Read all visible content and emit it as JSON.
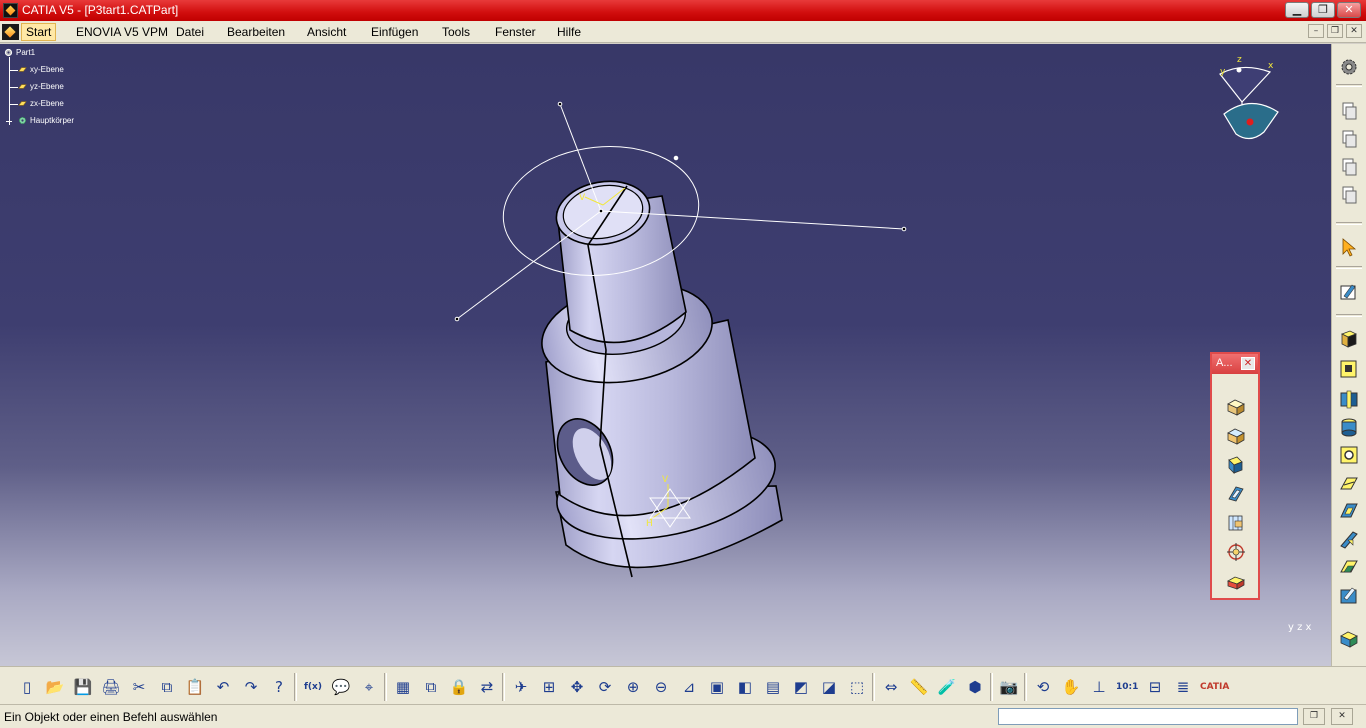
{
  "window": {
    "title": "CATIA V5 - [P3tart1.CATPart]",
    "minimize_glyph": "▁",
    "maximize_glyph": "❐",
    "close_glyph": "✕"
  },
  "menu": {
    "items": [
      "Start",
      "ENOVIA V5 VPM",
      "Datei",
      "Bearbeiten",
      "Ansicht",
      "Einfügen",
      "Tools",
      "Fenster",
      "Hilfe"
    ],
    "mdi_minimize": "–",
    "mdi_restore": "❐",
    "mdi_close": "✕"
  },
  "tree": {
    "root": "Part1",
    "planes": [
      "xy-Ebene",
      "yz-Ebene",
      "zx-Ebene"
    ],
    "body": "Hauptkörper"
  },
  "compass": {
    "x_label": "x",
    "y_label": "y",
    "z_label": "z"
  },
  "model_axis_labels": {
    "v": "V",
    "h": "H",
    "u": "U"
  },
  "axis_corner": {
    "label": "y z x"
  },
  "floating_toolbar": {
    "title": "A...",
    "close_glyph": "✕",
    "icons": [
      "pad-icon",
      "pocket-icon",
      "shaft-icon",
      "rib-icon",
      "stiffener-icon",
      "hole-icon",
      "solid-combine-icon"
    ]
  },
  "right_toolbar": {
    "icons": [
      "gear-icon",
      "copy-icon",
      "copy-icon",
      "copy-icon",
      "copy-icon",
      "select-arrow-icon",
      "sketch-icon",
      "pad-icon",
      "pocket-icon",
      "shaft-icon",
      "groove-icon",
      "hole-icon",
      "rib-icon",
      "slot-icon",
      "stiffener-icon",
      "multi-section-icon",
      "removed-multi-section-icon",
      "edge-fillet-icon"
    ]
  },
  "bottom_toolbar": {
    "icons": [
      "new-icon",
      "open-icon",
      "save-icon",
      "print-icon",
      "cut-icon",
      "copy-icon",
      "paste-icon",
      "undo-icon",
      "redo-icon",
      "whats-this-icon",
      "formula-icon",
      "comment-icon",
      "knowledge-icon",
      "table-icon",
      "tree-expand-icon",
      "lock-icon",
      "measure-icon",
      "fly-icon",
      "fit-all-icon",
      "pan-icon",
      "rotate-icon",
      "zoom-in-icon",
      "zoom-out-icon",
      "normal-view-icon",
      "quick-view-icon",
      "iso-view-icon",
      "view-mode-icon",
      "hide-show-icon",
      "swap-visible-icon",
      "apply-material-icon",
      "compass-reset-icon",
      "measure-between-icon",
      "measure-item-icon",
      "measure-inertia-icon",
      "capture-icon",
      "update-icon",
      "hand-icon",
      "axis-system-icon",
      "scale-icon",
      "constraint-icon",
      "stack-icon",
      "catia-logo-icon"
    ],
    "glyphs": [
      "▯",
      "📂",
      "💾",
      "🖨",
      "✂",
      "⧉",
      "📋",
      "↶",
      "↷",
      "?",
      "f(x)",
      "💬",
      "⌖",
      "▦",
      "⧉",
      "🔒",
      "⇄",
      "✈",
      "⊞",
      "✥",
      "⟳",
      "⊕",
      "⊖",
      "⊿",
      "▣",
      "◧",
      "▤",
      "◩",
      "◪",
      "⬚",
      "⇔",
      "📏",
      "🧪",
      "⬢",
      "📷",
      "⟲",
      "✋",
      "⊥",
      "10:1",
      "⊟",
      "≣",
      "CATIA"
    ]
  },
  "status": {
    "message": "Ein Objekt oder einen Befehl auswählen",
    "input_value": ""
  },
  "colors": {
    "title_bar": "#d10d0d",
    "viewport_top": "#383868",
    "viewport_bottom": "#c7c7d6",
    "part_fill": "#c8c8e8",
    "sketch_lines": "#ffffff"
  }
}
